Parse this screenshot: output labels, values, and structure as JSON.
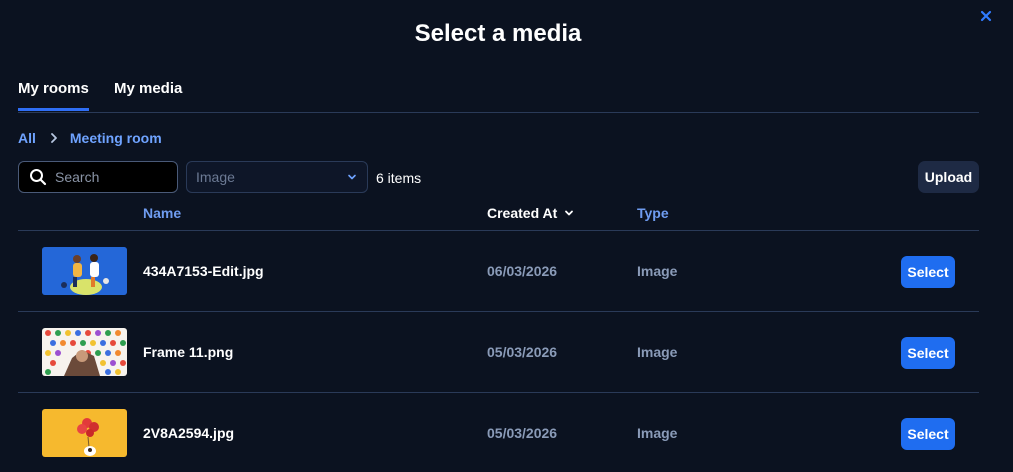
{
  "dialog": {
    "title": "Select a media",
    "close_icon": "close-icon"
  },
  "tabs": [
    {
      "label": "My rooms",
      "active": true
    },
    {
      "label": "My media",
      "active": false
    }
  ],
  "breadcrumb": {
    "items": [
      "All",
      "Meeting room"
    ],
    "separator_icon": "chevron-right-icon"
  },
  "toolbar": {
    "search_placeholder": "Search",
    "search_value": "",
    "filter_selected": "Image",
    "item_count": "6 items",
    "upload_label": "Upload"
  },
  "table": {
    "columns": {
      "name": "Name",
      "created_at": "Created At",
      "type": "Type"
    },
    "sort": {
      "column": "created_at",
      "icon": "chevron-down-icon"
    },
    "rows": [
      {
        "name": "434A7153-Edit.jpg",
        "created_at": "06/03/2026",
        "type": "Image",
        "action": "Select",
        "thumb": "people-on-blue-background"
      },
      {
        "name": "Frame 11.png",
        "created_at": "05/03/2026",
        "type": "Image",
        "action": "Select",
        "thumb": "colorful-dots-pattern"
      },
      {
        "name": "2V8A2594.jpg",
        "created_at": "05/03/2026",
        "type": "Image",
        "action": "Select",
        "thumb": "balloons-on-yellow-background"
      }
    ]
  },
  "colors": {
    "background": "#0b1220",
    "accent": "#1f6df0",
    "link": "#6fa3ff",
    "divider": "#2a3a58"
  }
}
